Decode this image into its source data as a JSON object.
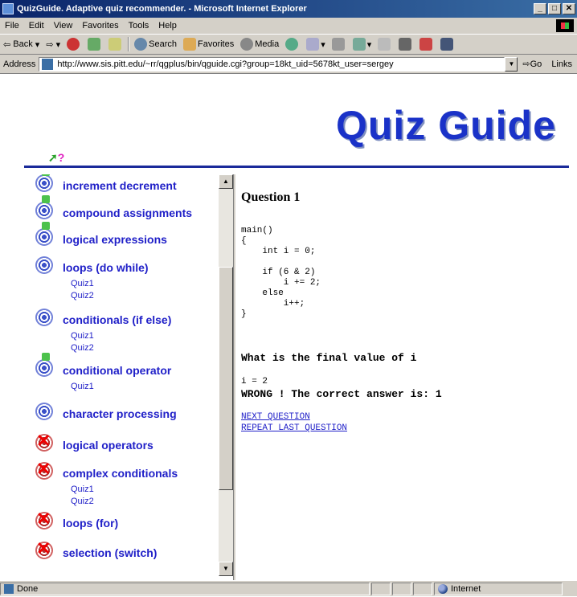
{
  "window": {
    "title": "QuizGuide. Adaptive quiz recommender. - Microsoft Internet Explorer",
    "buttons": [
      "_",
      "□",
      "✕"
    ]
  },
  "menu": [
    "File",
    "Edit",
    "View",
    "Favorites",
    "Tools",
    "Help"
  ],
  "toolbar": {
    "back": "Back",
    "search": "Search",
    "favorites": "Favorites",
    "media": "Media"
  },
  "address": {
    "label": "Address",
    "url": "http://www.sis.pitt.edu/~rr/qgplus/bin/qguide.cgi?group=18kt_uid=5678kt_user=sergey",
    "go": "Go",
    "links": "Links"
  },
  "banner": {
    "logo": "Quiz Guide",
    "mark_arrow": "➚",
    "mark_q": "?"
  },
  "topics": [
    {
      "label": "increment decrement",
      "state": "green",
      "quizzes": []
    },
    {
      "label": "compound assignments",
      "state": "green",
      "quizzes": []
    },
    {
      "label": "logical expressions",
      "state": "green",
      "quizzes": []
    },
    {
      "label": "loops (do while)",
      "state": "blue",
      "quizzes": [
        "Quiz1",
        "Quiz2"
      ]
    },
    {
      "label": "conditionals (if else)",
      "state": "blue",
      "quizzes": [
        "Quiz1",
        "Quiz2"
      ]
    },
    {
      "label": "conditional operator",
      "state": "green",
      "quizzes": [
        "Quiz1"
      ]
    },
    {
      "label": "character processing",
      "state": "blue",
      "quizzes": []
    },
    {
      "label": "logical operators",
      "state": "red",
      "quizzes": []
    },
    {
      "label": "complex conditionals",
      "state": "red",
      "quizzes": [
        "Quiz1",
        "Quiz2"
      ]
    },
    {
      "label": "loops (for)",
      "state": "red",
      "quizzes": []
    },
    {
      "label": "selection (switch)",
      "state": "red",
      "quizzes": []
    }
  ],
  "question": {
    "title": "Question 1",
    "code": "main()\n{\n    int i = 0;\n\n    if (6 & 2)\n        i += 2;\n    else\n        i++;\n}",
    "prompt": "What is the final value of i",
    "answer": "i = 2",
    "feedback": "WRONG ! The correct answer is: 1",
    "next_link": "NEXT QUESTION",
    "repeat_link": "REPEAT LAST QUESTION"
  },
  "status": {
    "text": "Done",
    "zone": "Internet"
  }
}
